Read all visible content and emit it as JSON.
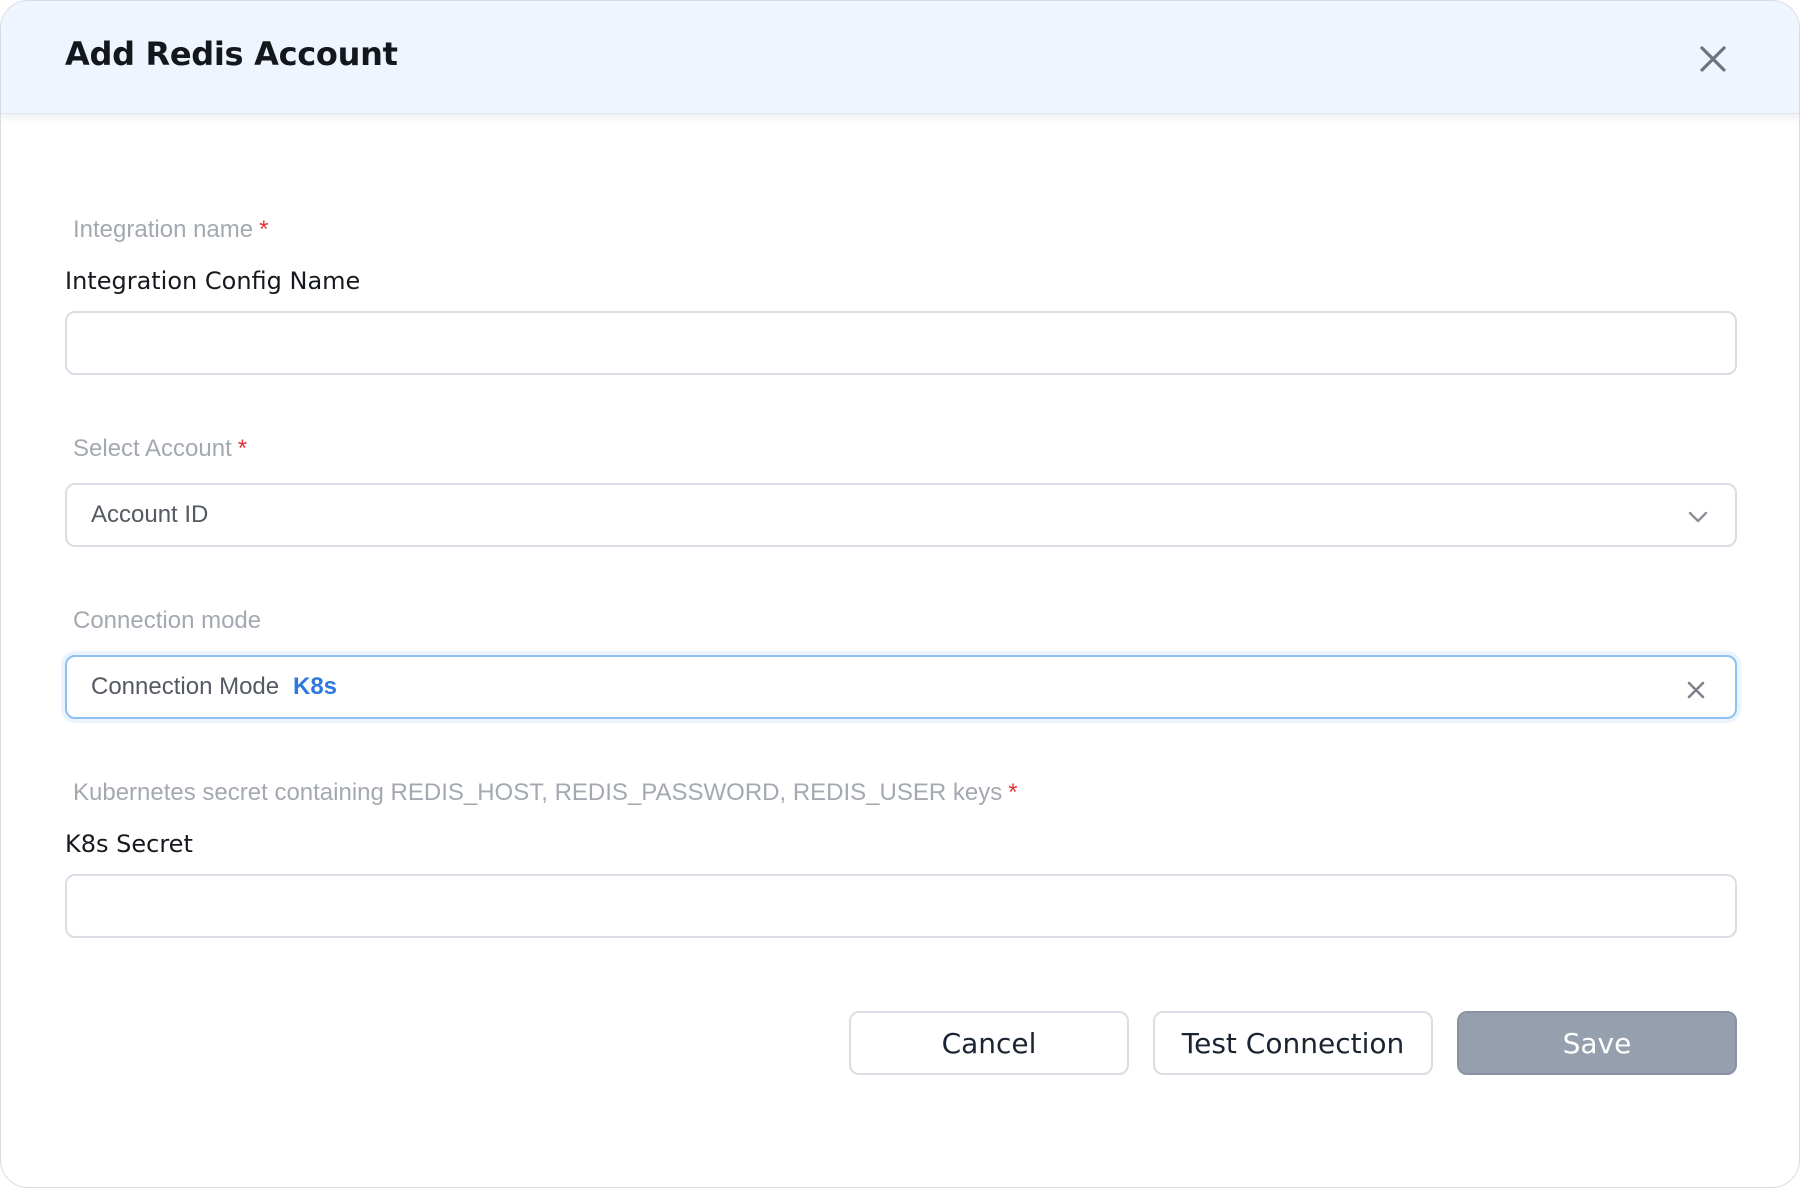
{
  "dialog": {
    "title": "Add Redis Account"
  },
  "form": {
    "integration_name": {
      "hint": "Integration name",
      "required_mark": "*",
      "label": "Integration Config Name",
      "value": "",
      "placeholder": ""
    },
    "select_account": {
      "hint": "Select Account",
      "required_mark": "*",
      "selected": "Account ID"
    },
    "connection_mode": {
      "hint": "Connection mode",
      "label": "Connection Mode",
      "value": "K8s"
    },
    "k8s_secret": {
      "hint": "Kubernetes secret containing REDIS_HOST, REDIS_PASSWORD, REDIS_USER keys",
      "required_mark": "*",
      "label": "K8s Secret",
      "value": "",
      "placeholder": ""
    }
  },
  "actions": {
    "cancel": "Cancel",
    "test_connection": "Test Connection",
    "save": "Save"
  },
  "colors": {
    "header_bg": "#eef5fe",
    "required": "#e0353d",
    "accent": "#2f78e0",
    "save_disabled": "#969fad"
  },
  "icons": {
    "close": "close-icon",
    "chevron": "chevron-down-icon",
    "clear": "clear-icon"
  }
}
